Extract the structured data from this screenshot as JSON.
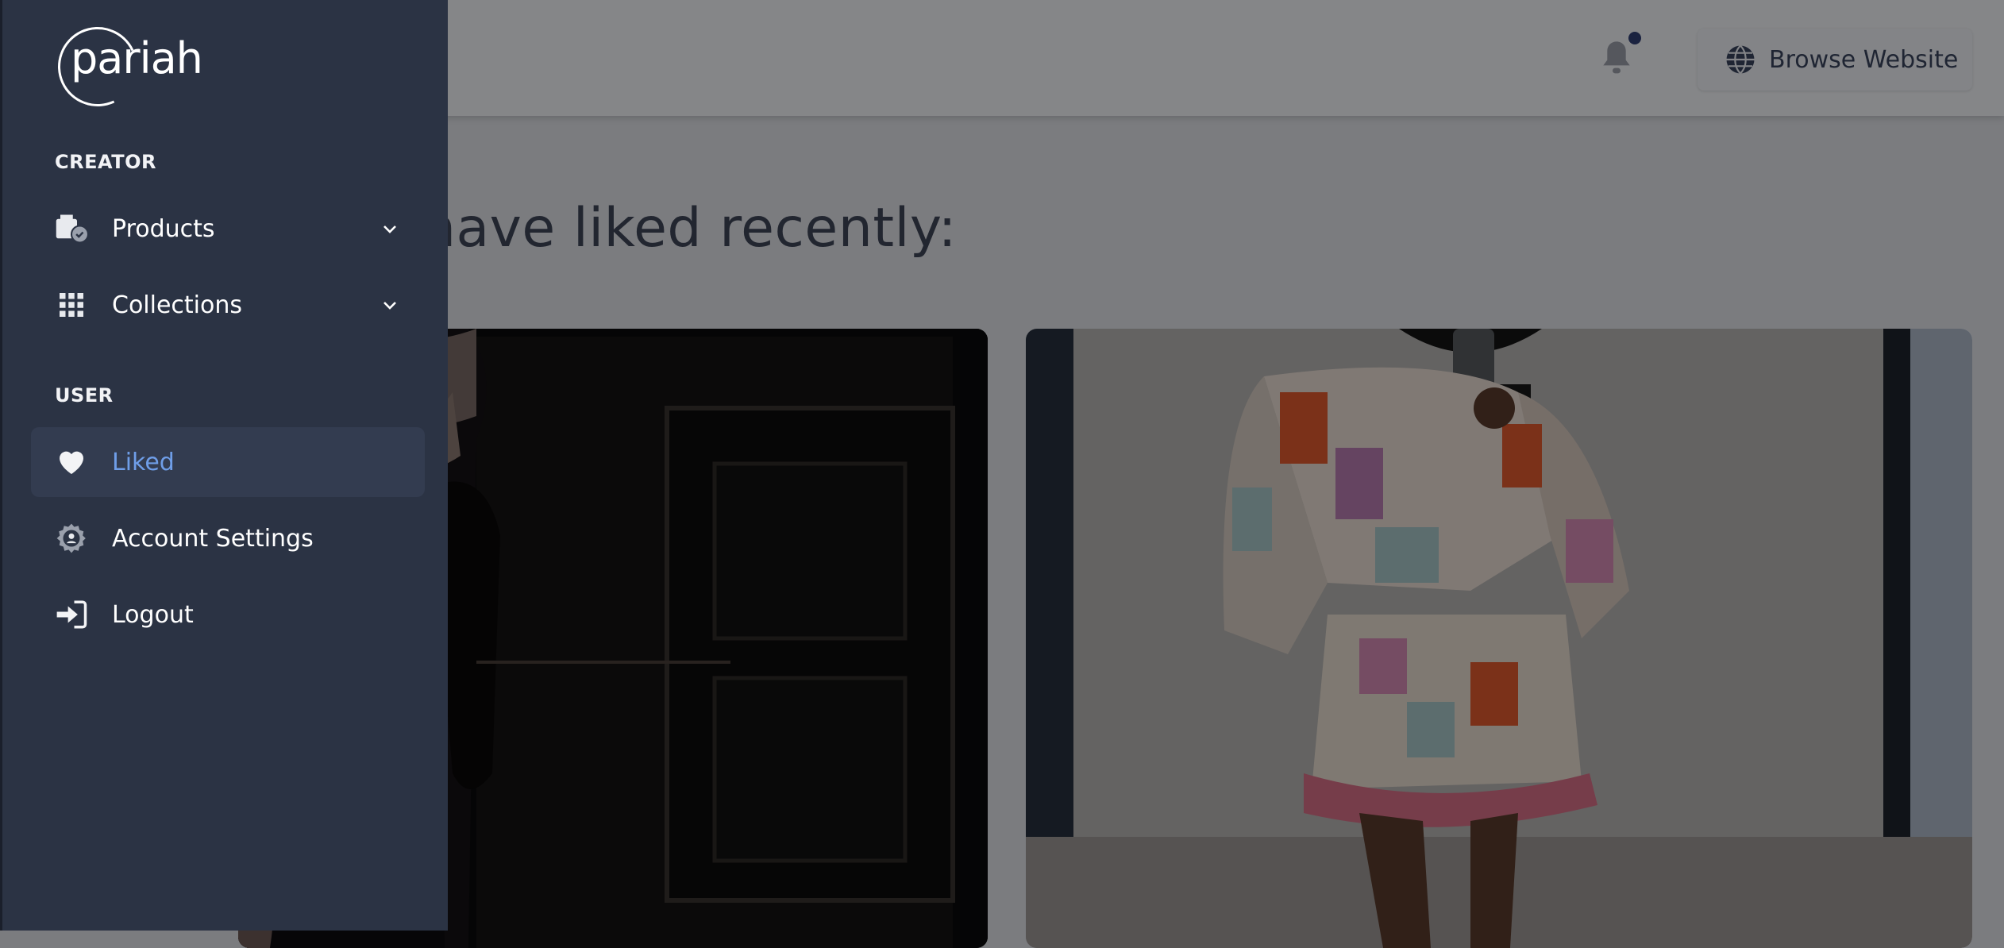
{
  "header": {
    "browse_label": "Browse Website"
  },
  "main": {
    "heading": "ler! You have liked recently:"
  },
  "sidebar": {
    "logo_text": "pariah",
    "creator_label": "CREATOR",
    "user_label": "USER",
    "items": [
      {
        "label": "Products",
        "icon": "box-check-icon"
      },
      {
        "label": "Collections",
        "icon": "grid-icon"
      },
      {
        "label": "Liked",
        "icon": "heart-icon",
        "active": true
      },
      {
        "label": "Account Settings",
        "icon": "gear-user-icon"
      },
      {
        "label": "Logout",
        "icon": "logout-icon"
      }
    ]
  },
  "colors": {
    "sidebar_bg": "#2b3344",
    "active_text": "#6f9ee8",
    "overlay": "#7b7c7f"
  }
}
